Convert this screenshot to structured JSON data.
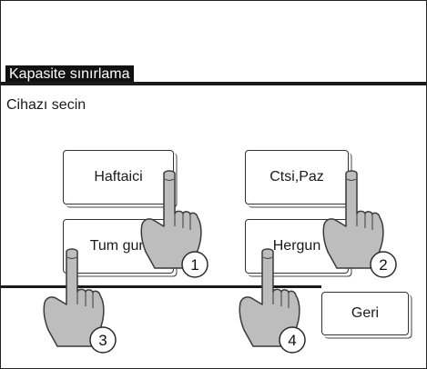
{
  "screen": {
    "title": "Kapasite sınırlama",
    "subtitle": "Cihazı secin"
  },
  "buttons": {
    "weekdays": "Haftaici",
    "weekend": "Ctsi,Paz",
    "all_day": "Tum gun",
    "everyday": "Hergun",
    "back": "Geri"
  },
  "callouts": [
    "1",
    "2",
    "3",
    "4"
  ]
}
